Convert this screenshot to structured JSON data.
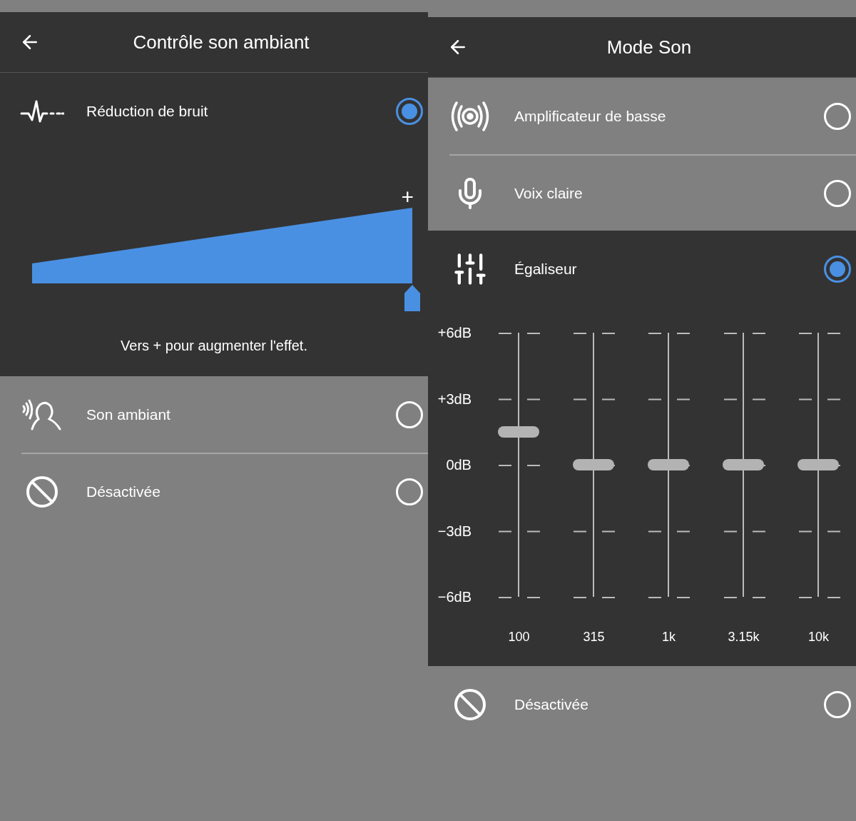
{
  "panels": [
    {
      "title": "Contrôle son ambiant",
      "options": [
        {
          "kind": "noise_reduction",
          "label": "Réduction de bruit",
          "selected": true,
          "slider": {
            "max_label": "+",
            "level": 1,
            "hint": "Vers + pour augmenter l'effet."
          }
        },
        {
          "kind": "ambient",
          "label": "Son ambiant",
          "selected": false
        },
        {
          "kind": "off",
          "label": "Désactivée",
          "selected": false
        }
      ]
    },
    {
      "title": "Mode Son",
      "options": [
        {
          "kind": "bass",
          "label": "Amplificateur de basse",
          "selected": false
        },
        {
          "kind": "voice",
          "label": "Voix claire",
          "selected": false
        },
        {
          "kind": "equalizer",
          "label": "Égaliseur",
          "selected": true,
          "equalizer": {
            "scale": [
              "+6dB",
              "+3dB",
              "0dB",
              "−3dB",
              "−6dB"
            ],
            "bands": [
              {
                "label": "100",
                "level": 0.625
              },
              {
                "label": "315",
                "level": 0.5
              },
              {
                "label": "1k",
                "level": 0.5
              },
              {
                "label": "3.15k",
                "level": 0.5
              },
              {
                "label": "10k",
                "level": 0.5
              }
            ]
          }
        },
        {
          "kind": "off",
          "label": "Désactivée",
          "selected": false
        }
      ]
    }
  ]
}
